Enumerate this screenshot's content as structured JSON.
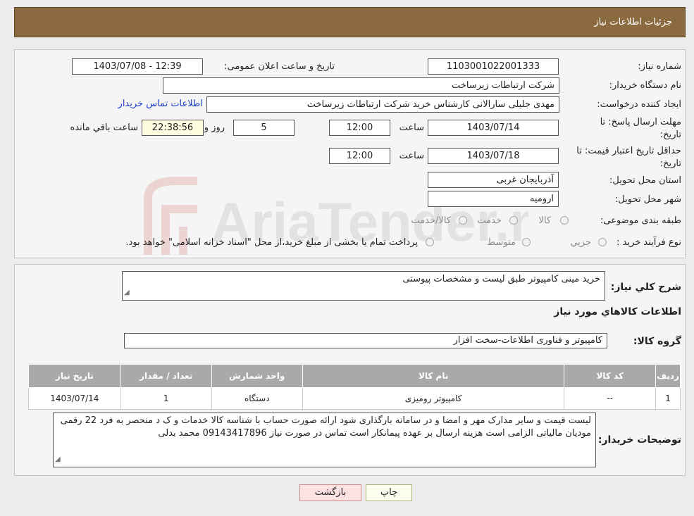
{
  "header": {
    "title": "جزئیات اطلاعات نیاز"
  },
  "form": {
    "need_number_label": "شماره نیاز:",
    "need_number": "1103001022001333",
    "announce_label": "تاریخ و ساعت اعلان عمومی:",
    "announce_value": "1403/07/08 - 12:39",
    "buyer_org_label": "نام دستگاه خریدار:",
    "buyer_org": "شرکت ارتباطات زیرساخت",
    "requester_label": "ایجاد کننده درخواست:",
    "requester": "مهدی جلیلی سارالانی کارشناس خرید شرکت ارتباطات زیرساخت",
    "contact_link": "اطلاعات تماس خریدار",
    "deadline_label_line1": "مهلت ارسال پاسخ: تا",
    "deadline_label_line2": "تاریخ:",
    "deadline_date": "1403/07/14",
    "time_label": "ساعت",
    "deadline_time": "12:00",
    "days_value": "5",
    "days_label": "روز و",
    "remaining_time": "22:38:56",
    "remaining_label": "ساعت باقي مانده",
    "validity_label_line1": "حداقل تاریخ اعتبار قیمت: تا",
    "validity_label_line2": "تاریخ:",
    "validity_date": "1403/07/18",
    "validity_time": "12:00",
    "province_label": "استان محل تحویل:",
    "province": "آذربایجان غربی",
    "city_label": "شهر محل تحویل:",
    "city": "ارومیه",
    "category_label": "طبقه بندی موضوعی:",
    "category_options": [
      "کالا",
      "خدمت",
      "کالا/خدمت"
    ],
    "process_label": "نوع فرآیند خرید :",
    "process_options": [
      "جزيي",
      "متوسط"
    ],
    "process_note": "پرداخت تمام یا بخشی از مبلغ خرید،از محل \"اسناد خزانه اسلامی\" خواهد بود."
  },
  "details": {
    "summary_label": "شرح کلي نياز:",
    "summary": "خرید مینی کامپیوتر طبق لیست و مشخصات پیوستی",
    "goods_info_title": "اطلاعات کالاهاي مورد نياز",
    "goods_group_label": "گروه کالا:",
    "goods_group": "کامپیوتر و فناوری اطلاعات-سخت افزار",
    "table": {
      "headers": [
        "رديف",
        "کد کالا",
        "نام کالا",
        "واحد شمارش",
        "تعداد / مقدار",
        "تاریخ نیاز"
      ],
      "rows": [
        [
          "1",
          "--",
          "کامپیوتر رومیزی",
          "دستگاه",
          "1",
          "1403/07/14"
        ]
      ]
    },
    "buyer_notes_label": "توضیحات خریدار:",
    "buyer_notes": "لیست قیمت و سایر مدارک مهر و امضا و در سامانه بارگذاری شود ارائه صورت حساب با شناسه کالا خدمات و ک د منحصر به فرد 22 رقمی مودیان مالیاتی الزامی است هزینه ارسال بر عهده پیمانکار است تماس در صورت نیاز 09143417896 محمد بدلی"
  },
  "buttons": {
    "print": "چاپ",
    "back": "بازگشت"
  },
  "watermark": {
    "text": "AriaTender.neT"
  },
  "colors": {
    "header_bg": "#8b6a3f",
    "link": "#1f3fc9",
    "table_header": "#a9a9a9",
    "back_button_bg": "#fde2e2"
  }
}
